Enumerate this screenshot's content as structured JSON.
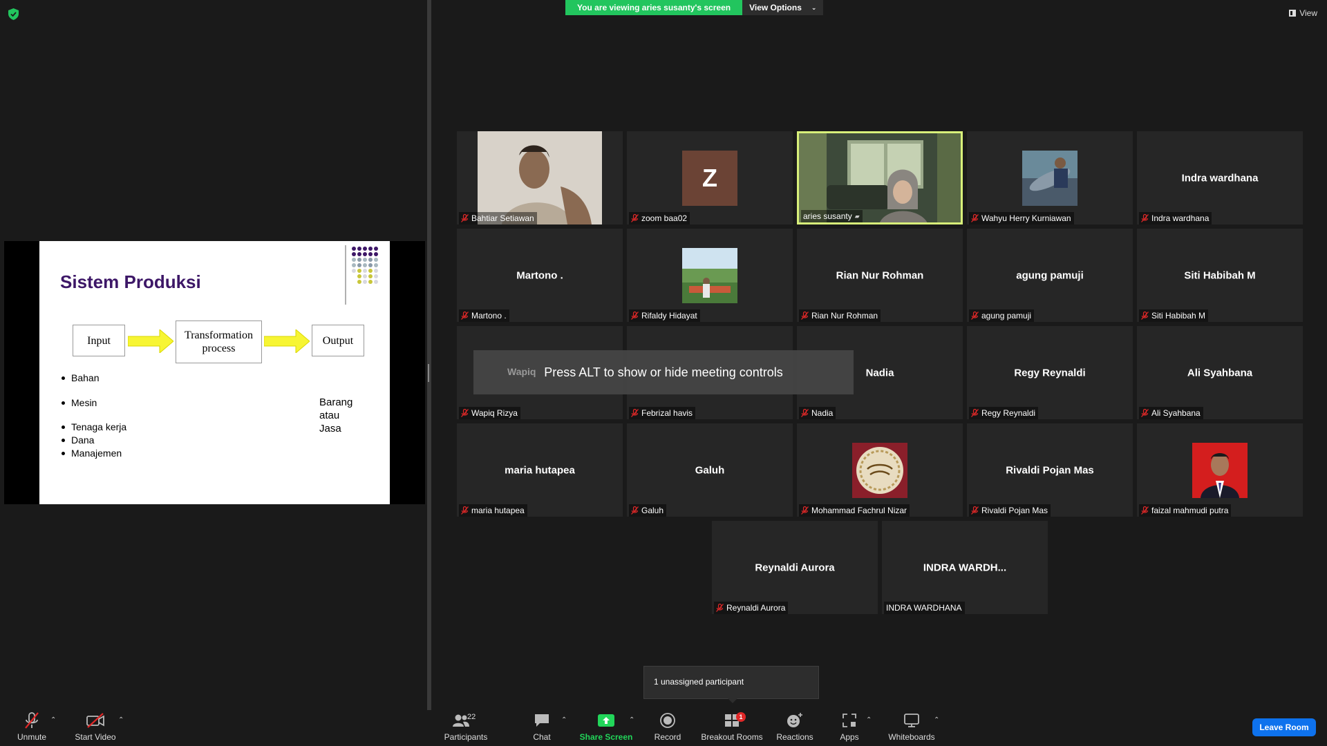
{
  "banner": {
    "viewing_text": "You are viewing aries susanty's screen",
    "view_options_label": "View Options",
    "view_label": "View"
  },
  "slide": {
    "title": "Sistem Produksi",
    "input_box": "Input",
    "process_box_line1": "Transformation",
    "process_box_line2": "process",
    "output_box": "Output",
    "bullets": [
      "Bahan",
      "Mesin",
      "Tenaga kerja",
      "Dana",
      "Manajemen"
    ],
    "result_lines": [
      "Barang",
      "atau",
      "Jasa"
    ]
  },
  "participants": [
    {
      "name": "Bahtiar Setiawan",
      "display": "",
      "muted": true
    },
    {
      "name": "zoom baa02",
      "display": "Z",
      "muted": true
    },
    {
      "name": "aries susanty",
      "display": "",
      "muted": false
    },
    {
      "name": "Wahyu Herry Kurniawan",
      "display": "",
      "muted": true
    },
    {
      "name": "Indra wardhana",
      "display": "Indra wardhana",
      "muted": true
    },
    {
      "name": "Martono .",
      "display": "Martono .",
      "muted": true
    },
    {
      "name": "Rifaldy Hidayat",
      "display": "",
      "muted": true
    },
    {
      "name": "Rian Nur Rohman",
      "display": "Rian Nur Rohman",
      "muted": true
    },
    {
      "name": "agung pamuji",
      "display": "agung pamuji",
      "muted": true
    },
    {
      "name": "Siti Habibah M",
      "display": "Siti Habibah M",
      "muted": true
    },
    {
      "name": "Wapiq Rizya",
      "display": "Wapiq",
      "muted": true
    },
    {
      "name": "Febrizal havis",
      "display": "",
      "muted": true
    },
    {
      "name": "Nadia",
      "display": "Nadia",
      "muted": true
    },
    {
      "name": "Regy Reynaldi",
      "display": "Regy Reynaldi",
      "muted": true
    },
    {
      "name": "Ali Syahbana",
      "display": "Ali Syahbana",
      "muted": true
    },
    {
      "name": "maria hutapea",
      "display": "maria hutapea",
      "muted": true
    },
    {
      "name": "Galuh",
      "display": "Galuh",
      "muted": true
    },
    {
      "name": "Mohammad Fachrul Nizar",
      "display": "",
      "muted": true
    },
    {
      "name": "Rivaldi Pojan Mas",
      "display": "Rivaldi Pojan Mas",
      "muted": true
    },
    {
      "name": "faizal mahmudi putra",
      "display": "",
      "muted": true
    },
    {
      "name": "Reynaldi Aurora",
      "display": "Reynaldi Aurora",
      "muted": true
    },
    {
      "name": "INDRA WARDHANA",
      "display": "INDRA  WARDH...",
      "muted": false
    }
  ],
  "overlay_text": "Press ALT to show or hide meeting controls",
  "unassigned_text": "1 unassigned participant",
  "toolbar": {
    "unmute": "Unmute",
    "start_video": "Start Video",
    "participants": "Participants",
    "participants_count": "22",
    "chat": "Chat",
    "share_screen": "Share Screen",
    "record": "Record",
    "breakout_rooms": "Breakout Rooms",
    "breakout_badge": "1",
    "reactions": "Reactions",
    "apps": "Apps",
    "whiteboards": "Whiteboards",
    "leave": "Leave Room"
  },
  "colors": {
    "share_green": "#22d65a",
    "active_speaker_border": "#d8f07a",
    "leave_blue": "#0e72ed",
    "slide_title": "#3d1767",
    "arrow_yellow": "#f7f533"
  }
}
